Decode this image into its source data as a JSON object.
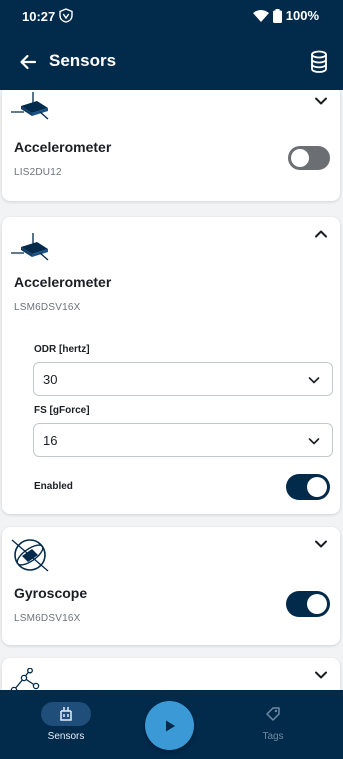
{
  "status_bar": {
    "time": "10:27",
    "battery": "100%"
  },
  "app_bar": {
    "title": "Sensors"
  },
  "sensors": [
    {
      "name": "Accelerometer",
      "part": "LIS2DU12",
      "enabled": false,
      "expanded": false,
      "icon": "accelerometer-icon"
    },
    {
      "name": "Accelerometer",
      "part": "LSM6DSV16X",
      "expanded": true,
      "icon": "accelerometer-icon",
      "settings": {
        "odr_label": "ODR [hertz]",
        "odr_value": "30",
        "fs_label": "FS [gForce]",
        "fs_value": "16",
        "enabled_label": "Enabled",
        "enabled": true
      }
    },
    {
      "name": "Gyroscope",
      "part": "LSM6DSV16X",
      "enabled": true,
      "expanded": false,
      "icon": "gyroscope-icon"
    },
    {
      "icon": "graph-nodes-icon",
      "expanded": false
    }
  ],
  "bottom_nav": {
    "items": [
      {
        "label": "Sensors",
        "icon": "sensors-icon",
        "selected": true
      },
      {
        "label": "Tags",
        "icon": "tag-icon",
        "selected": false
      }
    ],
    "fab_icon": "play-icon"
  },
  "colors": {
    "primary": "#022a4b",
    "accent": "#3b9ad6",
    "toggle_off": "#6b6f74"
  }
}
